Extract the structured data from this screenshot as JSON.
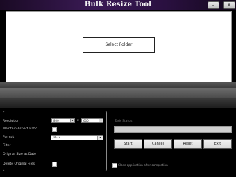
{
  "window": {
    "title": "Bulk Resize Tool",
    "minimize_glyph": "–",
    "close_glyph": "x"
  },
  "folder": {
    "select_label": "Select Folder"
  },
  "options": {
    "resolution_label": "Resolution",
    "width_value": "800",
    "height_value": "600",
    "x_label": "x",
    "maintain_aspect_label": "Maintain Aspect Ratio",
    "maintain_aspect_checked": false,
    "format_label": "Format",
    "format_value": "JPEG",
    "filter_label": "Filter",
    "original_size_label": "Original Size as Date",
    "delete_originals_label": "Delete Original Files",
    "delete_originals_checked": false
  },
  "task": {
    "status_label": "Task Status",
    "progress": 0
  },
  "actions": {
    "start_label": "Start",
    "cancel_label": "Cancel",
    "reset_label": "Reset",
    "exit_label": "Exit"
  },
  "footer": {
    "close_after_label": "Close application after completion",
    "close_after_checked": false
  },
  "colors": {
    "title_gradient_start": "#1a0a24",
    "title_gradient_mid": "#3a1a55",
    "background": "#000000",
    "progress_fill": "#3c9c3c"
  }
}
